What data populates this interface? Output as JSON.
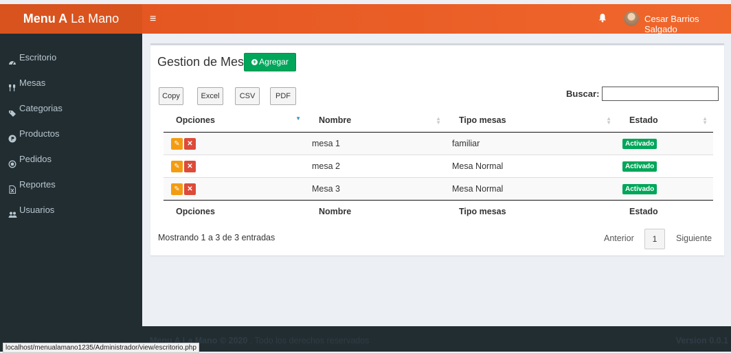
{
  "app": {
    "logo_bold": "Menu A",
    "logo_rest": " La Mano",
    "user_name": "Cesar Barrios Salgado"
  },
  "sidebar": {
    "items": [
      {
        "label": "Escritorio",
        "icon": "dashboard-icon"
      },
      {
        "label": "Mesas",
        "icon": "utensils-icon"
      },
      {
        "label": "Categorias",
        "icon": "tags-icon"
      },
      {
        "label": "Productos",
        "icon": "product-hunt-icon"
      },
      {
        "label": "Pedidos",
        "icon": "radio-circle-icon"
      },
      {
        "label": "Reportes",
        "icon": "file-excel-icon"
      },
      {
        "label": "Usuarios",
        "icon": "users-icon"
      }
    ]
  },
  "main": {
    "title": "Gestion de Mesas",
    "add_label": "Agregar",
    "export_buttons": [
      "Copy",
      "Excel",
      "CSV",
      "PDF"
    ],
    "search_label": "Buscar:",
    "search_value": "",
    "columns": [
      "Opciones",
      "Nombre",
      "Tipo mesas",
      "Estado"
    ],
    "rows": [
      {
        "nombre": "mesa 1",
        "tipo": "familiar",
        "estado": "Activado"
      },
      {
        "nombre": "mesa 2",
        "tipo": "Mesa Normal",
        "estado": "Activado"
      },
      {
        "nombre": "Mesa 3",
        "tipo": "Mesa Normal",
        "estado": "Activado"
      }
    ],
    "info": "Mostrando 1 a 3 de 3 entradas",
    "pagination": {
      "prev": "Anterior",
      "page": "1",
      "next": "Siguiente"
    }
  },
  "footer": {
    "brand": "Menu A La Mano © 2020",
    "rights": " . Todo los derechos reservados",
    "version": "Version 0.0.1"
  },
  "status_url": "localhost/menualamano1235/Administrador/view/escritorio.php",
  "colors": {
    "header": "#e8571f",
    "sidebar": "#222d32",
    "success": "#00a65a",
    "warning": "#f39c12",
    "danger": "#dd4b39"
  }
}
